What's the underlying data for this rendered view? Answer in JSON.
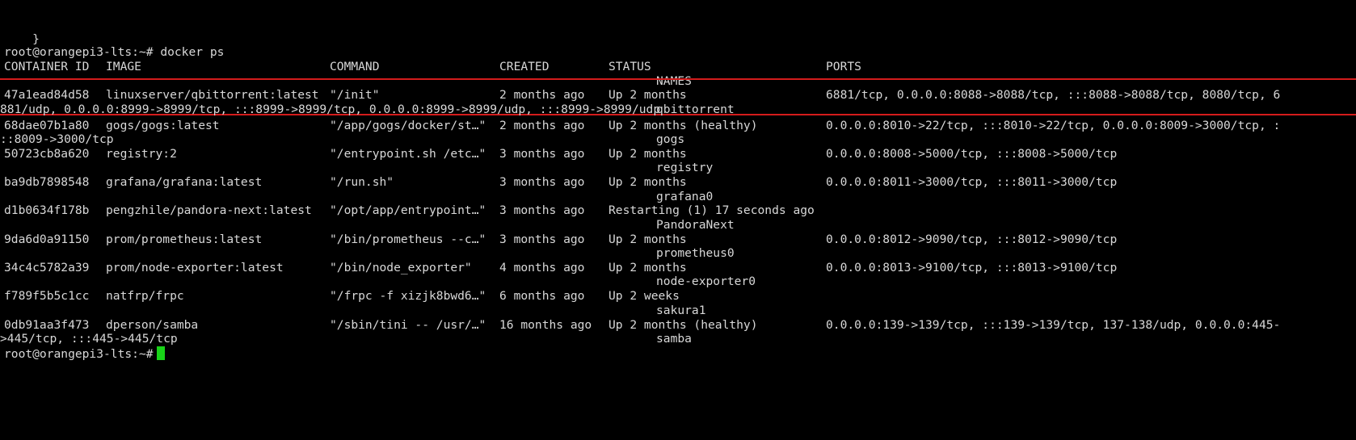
{
  "window": {
    "title": "root@orangepi3-lts: ~"
  },
  "colors": {
    "background": "#000000",
    "text": "#d8d8d8",
    "highlight": "#d41c1c",
    "cursor": "#18d418"
  },
  "lines": {
    "brace": "}",
    "prompt": "root@orangepi3-lts:~#",
    "command": "docker ps",
    "final_prompt": "root@orangepi3-lts:~#"
  },
  "headers": {
    "container_id": "CONTAINER ID",
    "image": "IMAGE",
    "command": "COMMAND",
    "created": "CREATED",
    "status": "STATUS",
    "ports": "PORTS",
    "names": "NAMES"
  },
  "rows": [
    {
      "id": "47a1ead84d58",
      "image": "linuxserver/qbittorrent:latest",
      "command": "\"/init\"",
      "created": "2 months ago",
      "status": "Up 2 months",
      "ports": "6881/tcp, 0.0.0.0:8088->8088/tcp, :::8088->8088/tcp, 8080/tcp, 6",
      "cont": "881/udp, 0.0.0.0:8999->8999/tcp, :::8999->8999/tcp, 0.0.0.0:8999->8999/udp, :::8999->8999/udp",
      "name": "qbittorrent"
    },
    {
      "id": "68dae07b1a80",
      "image": "gogs/gogs:latest",
      "command": "\"/app/gogs/docker/st…\"",
      "created": "2 months ago",
      "status": "Up 2 months (healthy)",
      "ports": "0.0.0.0:8010->22/tcp, :::8010->22/tcp, 0.0.0.0:8009->3000/tcp, :",
      "cont": "::8009->3000/tcp",
      "name": "gogs"
    },
    {
      "id": "50723cb8a620",
      "image": "registry:2",
      "command": "\"/entrypoint.sh /etc…\"",
      "created": "3 months ago",
      "status": "Up 2 months",
      "ports": "0.0.0.0:8008->5000/tcp, :::8008->5000/tcp",
      "cont": "",
      "name": "registry"
    },
    {
      "id": "ba9db7898548",
      "image": "grafana/grafana:latest",
      "command": "\"/run.sh\"",
      "created": "3 months ago",
      "status": "Up 2 months",
      "ports": "0.0.0.0:8011->3000/tcp, :::8011->3000/tcp",
      "cont": "",
      "name": "grafana0"
    },
    {
      "id": "d1b0634f178b",
      "image": "pengzhile/pandora-next:latest",
      "command": "\"/opt/app/entrypoint…\"",
      "created": "3 months ago",
      "status": "Restarting (1) 17 seconds ago",
      "ports": "",
      "cont": "",
      "name": "PandoraNext"
    },
    {
      "id": "9da6d0a91150",
      "image": "prom/prometheus:latest",
      "command": "\"/bin/prometheus --c…\"",
      "created": "3 months ago",
      "status": "Up 2 months",
      "ports": "0.0.0.0:8012->9090/tcp, :::8012->9090/tcp",
      "cont": "",
      "name": "prometheus0"
    },
    {
      "id": "34c4c5782a39",
      "image": "prom/node-exporter:latest",
      "command": "\"/bin/node_exporter\"",
      "created": "4 months ago",
      "status": "Up 2 months",
      "ports": "0.0.0.0:8013->9100/tcp, :::8013->9100/tcp",
      "cont": "",
      "name": "node-exporter0"
    },
    {
      "id": "f789f5b5c1cc",
      "image": "natfrp/frpc",
      "command": "\"/frpc -f xizjk8bwd6…\"",
      "created": "6 months ago",
      "status": "Up 2 weeks",
      "ports": "",
      "cont": "",
      "name": "sakura1"
    },
    {
      "id": "0db91aa3f473",
      "image": "dperson/samba",
      "command": "\"/sbin/tini -- /usr/…\"",
      "created": "16 months ago",
      "status": "Up 2 months (healthy)",
      "ports": "0.0.0.0:139->139/tcp, :::139->139/tcp, 137-138/udp, 0.0.0.0:445-",
      "cont": ">445/tcp, :::445->445/tcp",
      "name": "samba"
    }
  ]
}
